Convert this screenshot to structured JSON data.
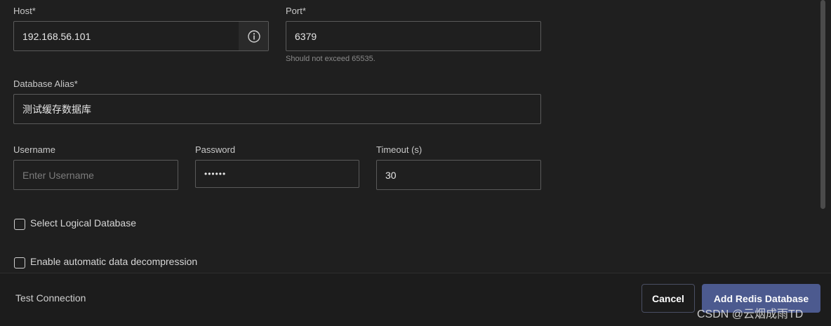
{
  "form": {
    "host": {
      "label": "Host*",
      "value": "192.168.56.101",
      "info_icon": "info-circle-icon"
    },
    "port": {
      "label": "Port*",
      "value": "6379",
      "hint": "Should not exceed 65535."
    },
    "alias": {
      "label": "Database Alias*",
      "value": "测试缓存数据库"
    },
    "username": {
      "label": "Username",
      "value": "",
      "placeholder": "Enter Username"
    },
    "password": {
      "label": "Password",
      "value": "••••••"
    },
    "timeout": {
      "label": "Timeout (s)",
      "value": "30"
    },
    "logical_db": {
      "label": "Select Logical Database",
      "checked": false
    },
    "decompression": {
      "label": "Enable automatic data decompression",
      "checked": false
    }
  },
  "footer": {
    "test_connection": "Test Connection",
    "cancel": "Cancel",
    "add": "Add Redis Database"
  },
  "watermark": "CSDN @云烟成雨TD",
  "colors": {
    "background": "#1f1f1f",
    "input_border": "#5a5a5a",
    "primary_button": "#4c5a8f",
    "footer_background": "#1c1c1c"
  }
}
